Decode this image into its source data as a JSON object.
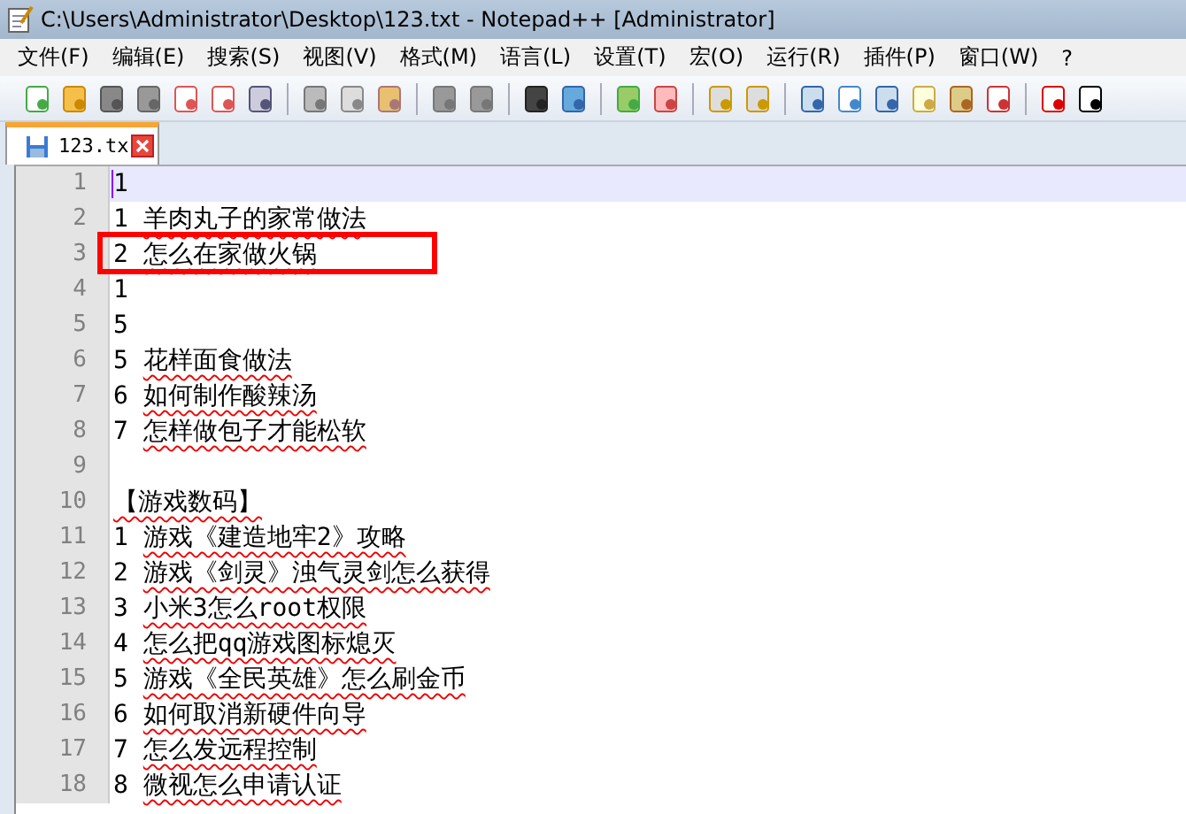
{
  "window": {
    "title": "C:\\Users\\Administrator\\Desktop\\123.txt - Notepad++ [Administrator]"
  },
  "menu": [
    "文件(F)",
    "编辑(E)",
    "搜索(S)",
    "视图(V)",
    "格式(M)",
    "语言(L)",
    "设置(T)",
    "宏(O)",
    "运行(R)",
    "插件(P)",
    "窗口(W)",
    "?"
  ],
  "tabs": [
    {
      "label": "123.tx",
      "selected": true
    }
  ],
  "lines": [
    {
      "number": "1",
      "prefix": "1",
      "current": true
    },
    {
      "number": "2",
      "prefix": "1",
      "text": "羊肉丸子的家常做法",
      "current": false
    },
    {
      "number": "3",
      "prefix": "2",
      "text": "怎么在家做火锅",
      "current": false
    },
    {
      "number": "4",
      "prefix": "1",
      "current": false
    },
    {
      "number": "5",
      "prefix": "5",
      "current": false
    },
    {
      "number": "6",
      "prefix": "5",
      "text": "花样面食做法",
      "current": false
    },
    {
      "number": "7",
      "prefix": "6",
      "text": "如何制作酸辣汤",
      "current": false
    },
    {
      "number": "8",
      "prefix": "7",
      "text": "怎样做包子才能松软",
      "current": false
    },
    {
      "number": "9",
      "current": false
    },
    {
      "number": "10",
      "text": "【游戏数码】",
      "current": false
    },
    {
      "number": "11",
      "prefix": "1",
      "text": "游戏《建造地牢2》攻略",
      "current": false
    },
    {
      "number": "12",
      "prefix": "2",
      "text": "游戏《剑灵》浊气灵剑怎么获得",
      "current": false
    },
    {
      "number": "13",
      "prefix": "3",
      "text": "小米3怎么root权限",
      "current": false
    },
    {
      "number": "14",
      "prefix": "4",
      "text": "怎么把qq游戏图标熄灭",
      "current": false
    },
    {
      "number": "15",
      "prefix": "5",
      "text": "游戏《全民英雄》怎么刷金币",
      "current": false
    },
    {
      "number": "16",
      "prefix": "6",
      "text": "如何取消新硬件向导",
      "current": false
    },
    {
      "number": "17",
      "prefix": "7",
      "text": "怎么发远程控制",
      "current": false
    },
    {
      "number": "18",
      "prefix": "8",
      "text": "微视怎么申请认证",
      "current": false
    }
  ]
}
